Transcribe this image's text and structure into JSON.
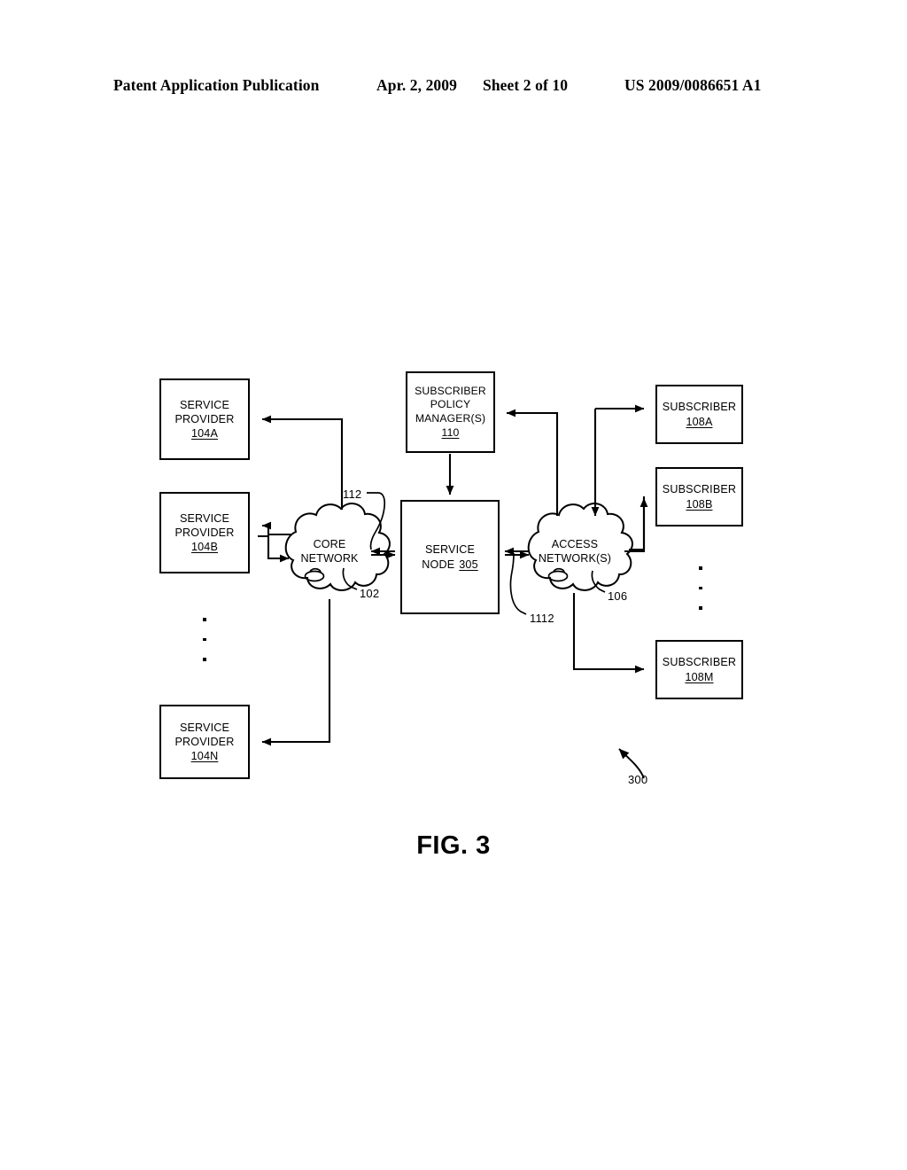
{
  "header": {
    "publication": "Patent Application Publication",
    "date": "Apr. 2, 2009",
    "sheet": "Sheet 2 of 10",
    "patent_number": "US 2009/0086651 A1"
  },
  "figure": {
    "caption": "FIG. 3",
    "diagram_ref": "300"
  },
  "nodes": {
    "service_provider_a": {
      "line1": "SERVICE",
      "line2": "PROVIDER",
      "ref": "104A"
    },
    "service_provider_b": {
      "line1": "SERVICE",
      "line2": "PROVIDER",
      "ref": "104B"
    },
    "service_provider_n": {
      "line1": "SERVICE",
      "line2": "PROVIDER",
      "ref": "104N"
    },
    "subscriber_policy_manager": {
      "line1": "SUBSCRIBER",
      "line2": "POLICY",
      "line3": "MANAGER(S)",
      "ref": "110"
    },
    "service_node": {
      "line1": "SERVICE",
      "line2": "NODE",
      "ref": "305"
    },
    "subscriber_a": {
      "line1": "SUBSCRIBER",
      "ref": "108A"
    },
    "subscriber_b": {
      "line1": "SUBSCRIBER",
      "ref": "108B"
    },
    "subscriber_m": {
      "line1": "SUBSCRIBER",
      "ref": "108M"
    }
  },
  "clouds": {
    "core_network": {
      "line1": "CORE",
      "line2": "NETWORK",
      "ref": "102"
    },
    "access_network": {
      "line1": "ACCESS",
      "line2": "NETWORK(S)",
      "ref": "106"
    }
  },
  "reference_numerals": {
    "core_to_service_node_link": "112",
    "service_node_to_access_link": "1112",
    "core_network": "102",
    "access_network": "106",
    "system": "300"
  },
  "colors": {
    "ink": "#000000",
    "paper": "#ffffff"
  },
  "ellipsis": "•"
}
